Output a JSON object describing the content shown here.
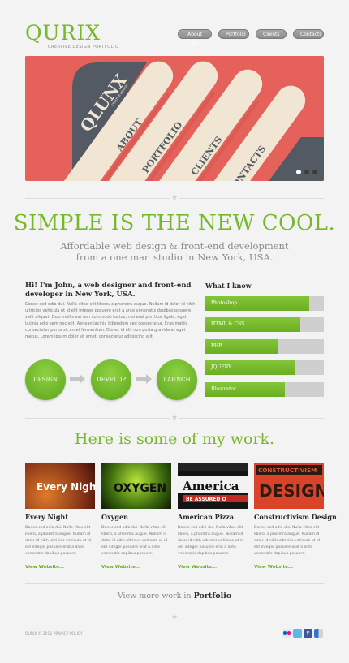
{
  "brand": {
    "name": "QURIX",
    "tagline": "CREATIVE DESIGN PORTFOLIO"
  },
  "nav": [
    {
      "label": "About Me"
    },
    {
      "label": "Portfolio"
    },
    {
      "label": "Clients"
    },
    {
      "label": "Contacts"
    }
  ],
  "slider": {
    "logo": "QLUNX",
    "logo_sub": "CREATIVE DESIGN",
    "items": [
      "ABOUT",
      "PORTFOLIO",
      "CLIENTS",
      "CONTACTS"
    ],
    "active_slide": 1,
    "slide_count": 3
  },
  "hero": {
    "headline": "SIMPLE IS THE NEW COOL.",
    "subline": "Affordable web design & front-end development from a one man studio in New York, USA."
  },
  "intro": {
    "title": "Hi! I'm John, a web designer and front-end developer in New York, USA.",
    "body": "Donec sed odio dui. Nulla vitae elit libero, a pharetra augue. Nullam id dolor id nibh ultricies vehicula ut id elit integer posuere erat a ante venenatis dapibus posuere velit aliquet. Duis mollis est non commodo luctus, nisi erat porttitor ligula, eget lacinia odio sem nec elit. Aenean lacinia bibendum sed consectetur. Cras mattis consectetur purus sit amet fermentum. Donec id elit non porta gravida at eget metus. Lorem ipsum dolor sit amet, consectetur adipiscing elit."
  },
  "process": [
    "DESIGN",
    "DEVELOP",
    "LAUNCH"
  ],
  "skills": {
    "title": "What I know",
    "items": [
      {
        "label": "Photoshop",
        "level": 0.88
      },
      {
        "label": "HTML & CSS",
        "level": 0.8
      },
      {
        "label": "PHP",
        "level": 0.61
      },
      {
        "label": "JQUERY",
        "level": 0.75
      },
      {
        "label": "Illustrator",
        "level": 0.67
      }
    ]
  },
  "work": {
    "title": "Here is some of my work.",
    "projects": [
      {
        "title": "Every Night",
        "thumb_text": "Every Night!",
        "body": "Donec sed odio dui. Nulla vitae elit libero, a pharetra augue. Nullam id dolor id nibh ultricies vehicula ut id elit integer posuere erat a ante venenatis dapibus posuere.",
        "link": "View Website..."
      },
      {
        "title": "Oxygen",
        "thumb_text": "OXYGEN",
        "body": "Donec sed odio dui. Nulla vitae elit libero, a pharetra augue. Nullam id dolor id nibh ultricies vehicula ut id elit integer posuere erat a ante venenatis dapibus posuere.",
        "link": "View Website..."
      },
      {
        "title": "American Pizza",
        "thumb_text": "America",
        "thumb_sub": "BE ASSURED O",
        "body": "Donec sed odio dui. Nulla vitae elit libero, a pharetra augue. Nullam id dolor id nibh ultricies vehicula ut id elit integer posuere erat a ante venenatis dapibus posuere.",
        "link": "View Website..."
      },
      {
        "title": "Constructivism Design",
        "thumb_text": "CONSTRUCTIVISM",
        "thumb_sub": "DESIGN",
        "body": "Donec sed odio dui. Nulla vitae elit libero, a pharetra augue. Nullam id dolor id nibh ultricies vehicula ut id elit integer posuere erat a ante venenatis dapibus posuere.",
        "link": "View Website..."
      }
    ],
    "more_prefix": "View more work in ",
    "more_link": "Portfolio"
  },
  "footer": {
    "text": "QURIX © 2012 PRIVACY POLICY",
    "social": [
      "flickr-icon",
      "twitter-icon",
      "facebook-icon",
      "delicious-icon"
    ]
  },
  "colors": {
    "accent": "#76b82a",
    "slider_bg": "#e4625b",
    "skill_track": "#cfcfcf"
  }
}
